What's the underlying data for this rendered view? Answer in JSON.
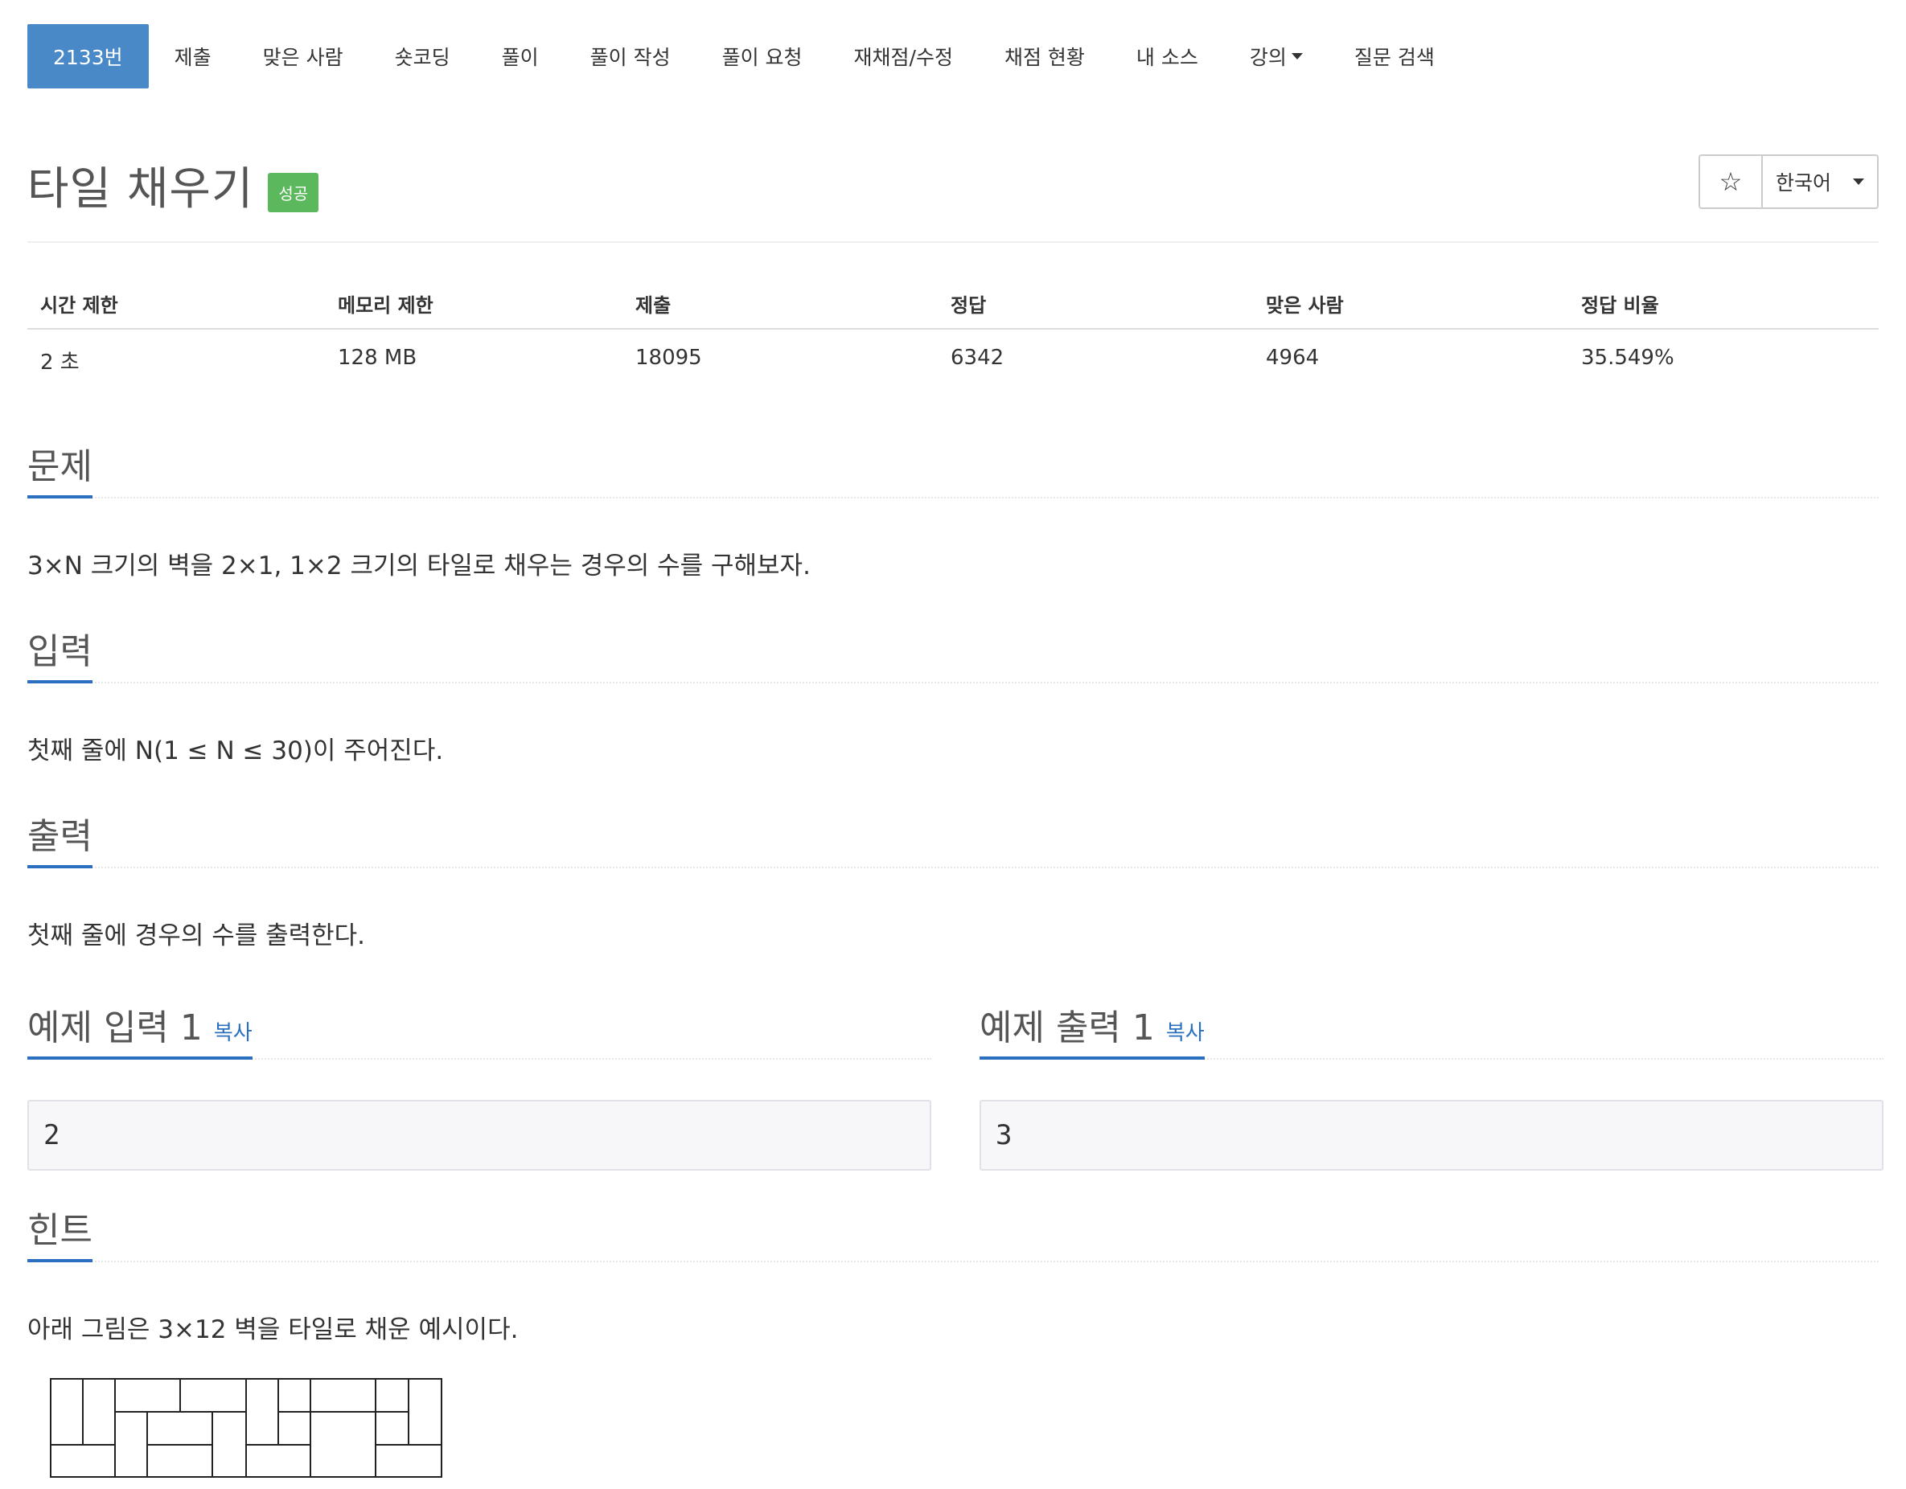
{
  "nav": {
    "items": [
      {
        "label": "2133번",
        "active": true
      },
      {
        "label": "제출"
      },
      {
        "label": "맞은 사람"
      },
      {
        "label": "숏코딩"
      },
      {
        "label": "풀이"
      },
      {
        "label": "풀이 작성"
      },
      {
        "label": "풀이 요청"
      },
      {
        "label": "재채점/수정"
      },
      {
        "label": "채점 현황"
      },
      {
        "label": "내 소스"
      },
      {
        "label": "강의",
        "dropdown": true
      },
      {
        "label": "질문 검색"
      }
    ]
  },
  "problem": {
    "title": "타일 채우기",
    "badge": "성공",
    "badge_color": "#5cb85c",
    "star_icon": "☆",
    "language": "한국어"
  },
  "info": {
    "headers": [
      "시간 제한",
      "메모리 제한",
      "제출",
      "정답",
      "맞은 사람",
      "정답 비율"
    ],
    "values": [
      "2 초",
      "128 MB",
      "18095",
      "6342",
      "4964",
      "35.549%"
    ]
  },
  "sections": {
    "problem": {
      "heading": "문제",
      "text": "3×N 크기의 벽을 2×1, 1×2 크기의 타일로 채우는 경우의 수를 구해보자."
    },
    "input": {
      "heading": "입력",
      "text": "첫째 줄에 N(1 ≤ N ≤ 30)이 주어진다."
    },
    "output": {
      "heading": "출력",
      "text": "첫째 줄에 경우의 수를 출력한다."
    },
    "hint": {
      "heading": "힌트",
      "text": "아래 그림은 3×12 벽을 타일로 채운 예시이다."
    }
  },
  "samples": {
    "input": {
      "heading": "예제 입력 1",
      "copy": "복사",
      "value": "2"
    },
    "output": {
      "heading": "예제 출력 1",
      "copy": "복사",
      "value": "3"
    }
  },
  "colors": {
    "accent": "#4a89c8",
    "heading_underline": "#2a6fc0",
    "success": "#5cb85c"
  }
}
